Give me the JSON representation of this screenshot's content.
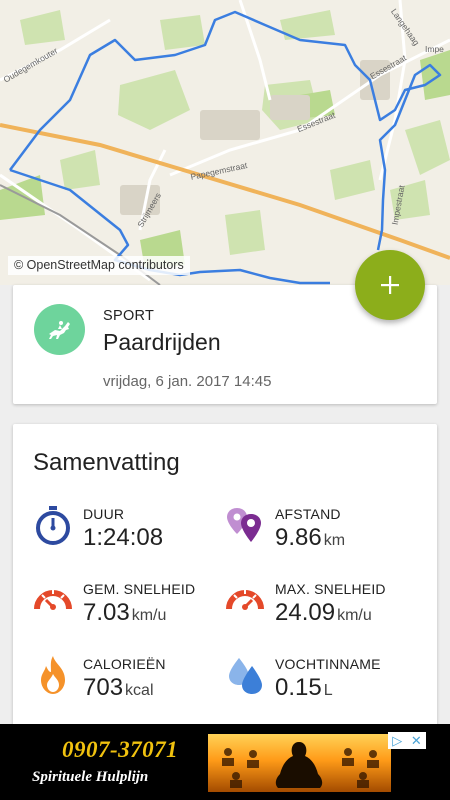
{
  "map": {
    "attribution": "© OpenStreetMap contributors",
    "street_labels": [
      "Essestraat",
      "Essestraat",
      "Papegemstraat",
      "Strijmeers",
      "Impestraat",
      "Langehaag",
      "Impe",
      "Oudegemkouter"
    ],
    "route_color": "#3b7ee0",
    "road_color": "#f0b35a"
  },
  "fab": {
    "icon": "plus-icon",
    "color": "#8cae1b"
  },
  "activity": {
    "type_label": "SPORT",
    "name": "Paardrijden",
    "datetime": "vrijdag, 6 jan. 2017 14:45",
    "icon": "horse-riding-icon",
    "icon_color": "#6ed49c"
  },
  "summary": {
    "title": "Samenvatting",
    "stats": [
      {
        "label": "DUUR",
        "value": "1:24:08",
        "unit": "",
        "icon": "stopwatch-icon"
      },
      {
        "label": "AFSTAND",
        "value": "9.86",
        "unit": "km",
        "icon": "map-pin-icon"
      },
      {
        "label": "GEM. SNELHEID",
        "value": "7.03",
        "unit": "km/u",
        "icon": "speedometer-icon"
      },
      {
        "label": "MAX. SNELHEID",
        "value": "24.09",
        "unit": "km/u",
        "icon": "speedometer-max-icon"
      },
      {
        "label": "CALORIEËN",
        "value": "703",
        "unit": "kcal",
        "icon": "flame-icon"
      },
      {
        "label": "VOCHTINNAME",
        "value": "0.15",
        "unit": "L",
        "icon": "water-drops-icon"
      }
    ]
  },
  "ad": {
    "phone": "0907-37071",
    "tagline": "Spirituele Hulplijn",
    "choices_icon": "ad-choices-icon",
    "close_icon": "close-icon"
  }
}
